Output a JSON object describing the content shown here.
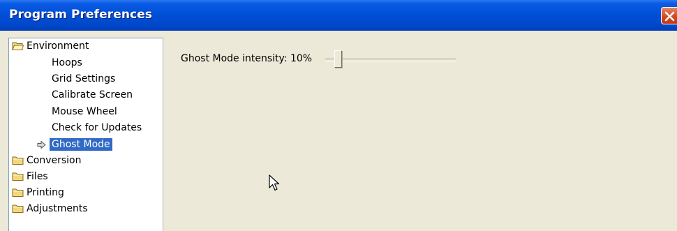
{
  "window": {
    "title": "Program Preferences"
  },
  "tree": {
    "items": [
      {
        "label": "Environment"
      },
      {
        "label": "Hoops"
      },
      {
        "label": "Grid Settings"
      },
      {
        "label": "Calibrate Screen"
      },
      {
        "label": "Mouse Wheel"
      },
      {
        "label": "Check for Updates"
      },
      {
        "label": "Ghost Mode",
        "selected": true
      },
      {
        "label": "Conversion"
      },
      {
        "label": "Files"
      },
      {
        "label": "Printing"
      },
      {
        "label": "Adjustments"
      }
    ]
  },
  "ghost_mode": {
    "label": "Ghost Mode intensity: 10%",
    "intensity_percent": 10
  },
  "colors": {
    "titlebar": "#0050d8",
    "selection": "#316ac5",
    "close_button": "#d0451c",
    "dialog_background": "#ece9d8"
  }
}
